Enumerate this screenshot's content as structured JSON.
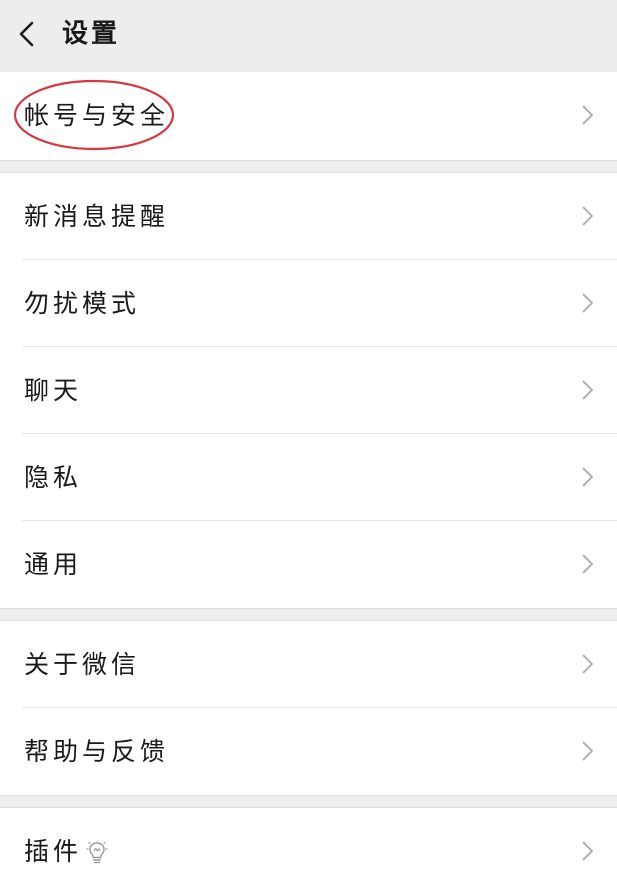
{
  "header": {
    "title": "设置"
  },
  "groups": [
    {
      "items": [
        {
          "label": "帐号与安全"
        }
      ]
    },
    {
      "items": [
        {
          "label": "新消息提醒"
        },
        {
          "label": "勿扰模式"
        },
        {
          "label": "聊天"
        },
        {
          "label": "隐私"
        },
        {
          "label": "通用"
        }
      ]
    },
    {
      "items": [
        {
          "label": "关于微信"
        },
        {
          "label": "帮助与反馈"
        }
      ]
    },
    {
      "items": [
        {
          "label": "插件"
        }
      ]
    }
  ],
  "colors": {
    "background": "#ededed",
    "row": "#ffffff",
    "highlight": "#d9363e",
    "chevron": "#b2b2b2"
  },
  "icons": {
    "back": "chevron-left-icon",
    "row_arrow": "chevron-right-icon",
    "plugin_badge": "lightbulb-icon"
  }
}
